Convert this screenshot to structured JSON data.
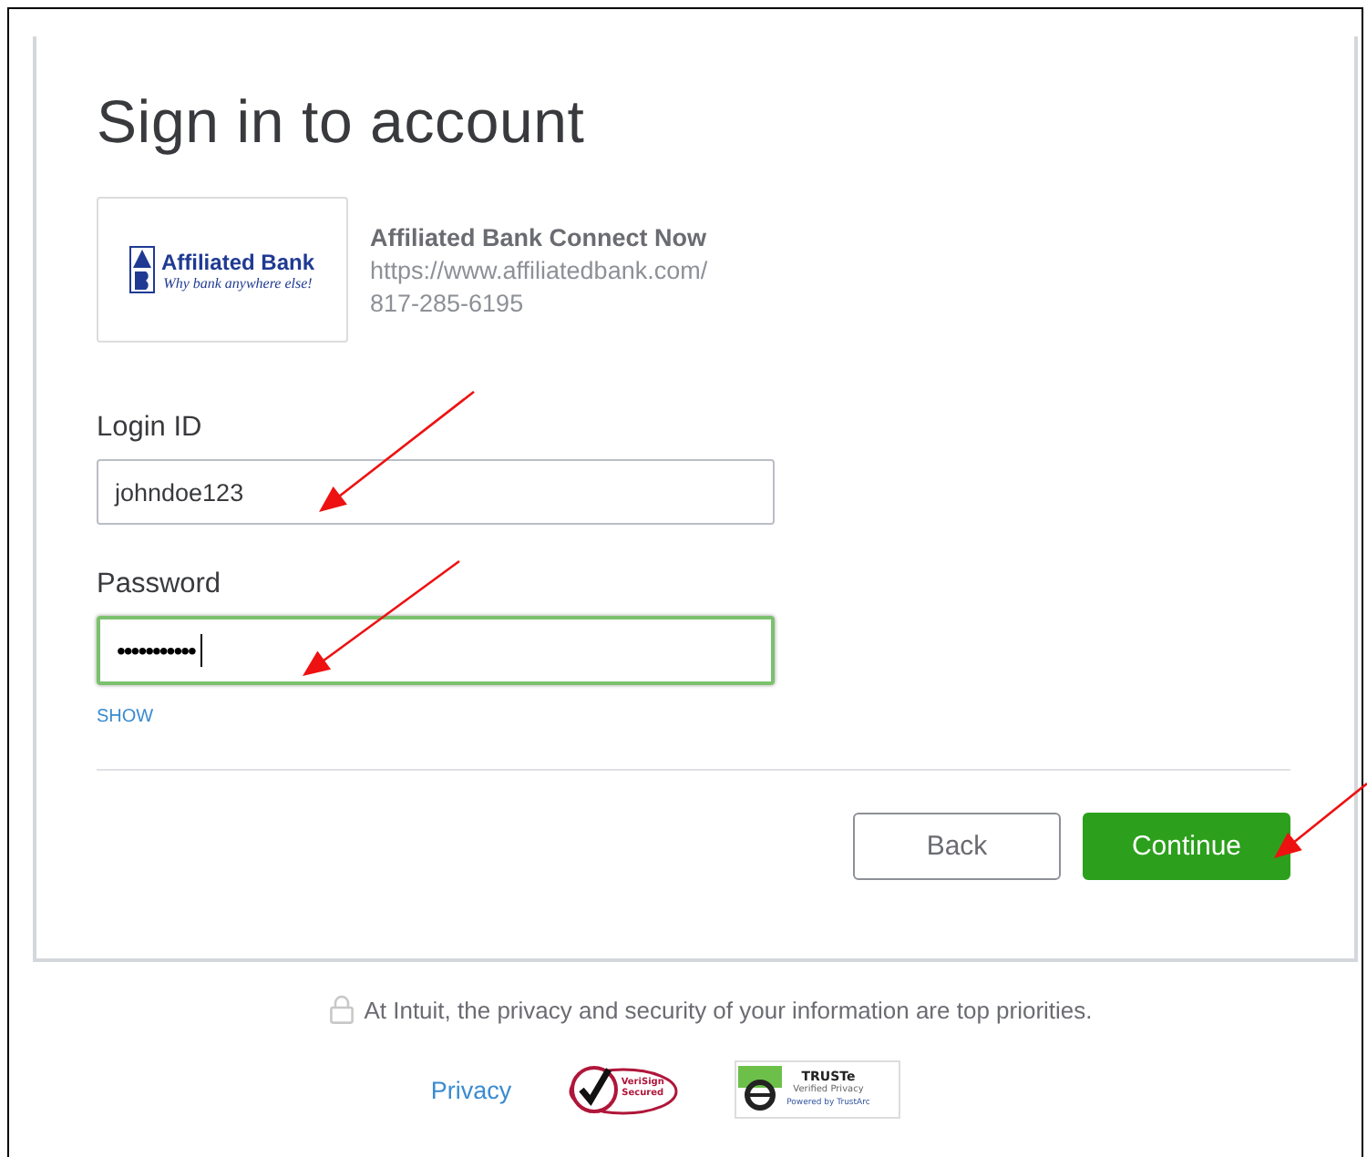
{
  "title": "Sign in to account",
  "bank": {
    "logo_name": "Affiliated Bank",
    "logo_slogan": "Why bank anywhere else!",
    "name": "Affiliated Bank Connect Now",
    "url": "https://www.affiliatedbank.com/",
    "phone": "817-285-6195"
  },
  "fields": [
    {
      "label": "Login ID",
      "value": "johndoe123",
      "focused": false,
      "kind": "text"
    },
    {
      "label": "Password",
      "value": "•••••••••••",
      "focused": true,
      "kind": "password"
    }
  ],
  "show_link": "SHOW",
  "buttons": [
    {
      "label": "Back",
      "kind": "secondary"
    },
    {
      "label": "Continue",
      "kind": "primary"
    }
  ],
  "footer": {
    "notice": "At Intuit, the privacy and security of your information are top priorities.",
    "privacy_link": "Privacy",
    "verisign_badge": "VeriSign Secured",
    "truste_badge": {
      "title": "TRUSTe",
      "subtitle": "Verified Privacy",
      "powered": "Powered by TrustArc"
    }
  }
}
